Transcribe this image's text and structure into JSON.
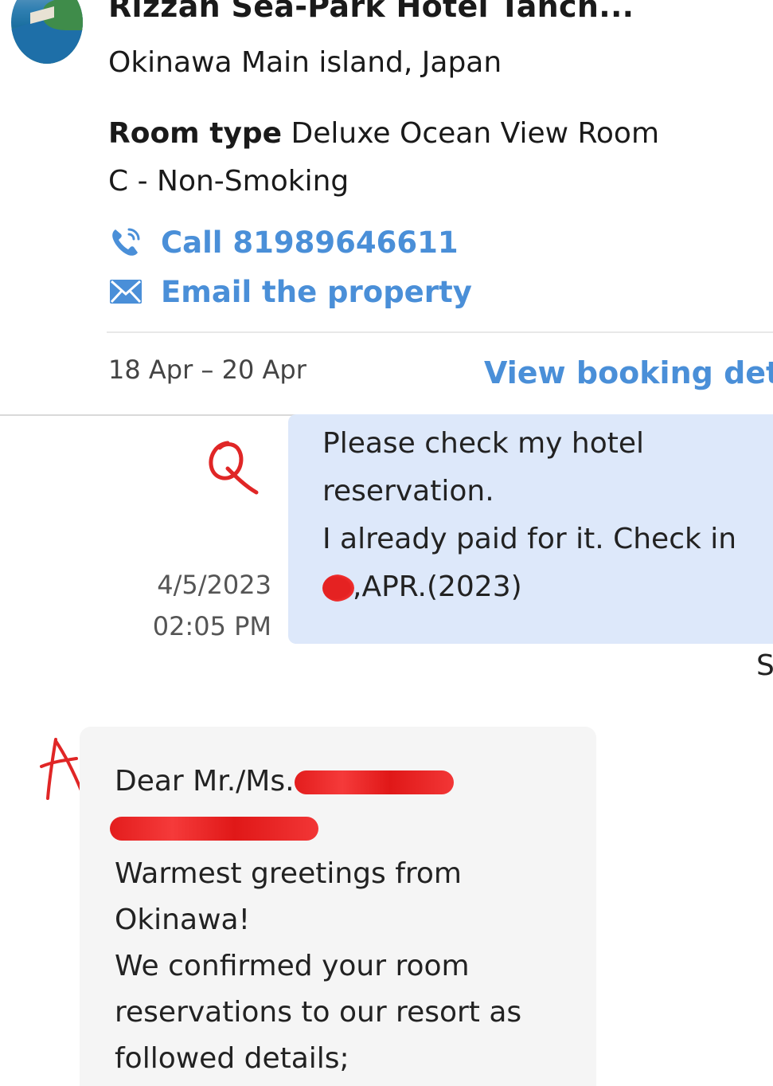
{
  "header": {
    "hotel_name": "Rizzan Sea-Park Hotel Tanch...",
    "location": "Okinawa Main island, Japan",
    "room_type_label": "Room type",
    "room_type_value": "Deluxe Ocean View Room C - Non-Smoking",
    "call_label": "Call 81989646611",
    "email_label": "Email the property",
    "dates": "18 Apr – 20 Apr",
    "view_booking_label": "View booking deta"
  },
  "messages": {
    "sent": {
      "line1": "Please check my hotel reservation.",
      "line2": "I already paid for it. Check in",
      "line3_suffix": ",APR.(2023)",
      "date": "4/5/2023",
      "time": "02:05 PM"
    },
    "edge_fragment": "S",
    "received": {
      "greeting_prefix": "Dear Mr./Ms.",
      "line_greetings": "Warmest greetings from Okinawa!",
      "line_confirm": "We confirmed your room reservations to our resort as followed details;"
    }
  },
  "icons": {
    "phone": "phone-icon",
    "email": "envelope-icon",
    "annotation_q": "handwritten-q-mark",
    "annotation_a": "handwritten-a-mark"
  },
  "colors": {
    "link": "#4a8fd8",
    "sent_bubble": "#dde8fa",
    "received_bubble": "#f5f5f5",
    "redaction": "#e52222"
  }
}
